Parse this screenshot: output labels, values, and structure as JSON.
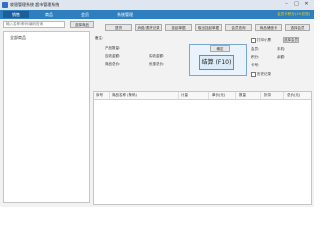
{
  "window": {
    "title": "收银管理系统 超市管理系统",
    "min_icon": "minimize-icon",
    "max_icon": "maximize-icon",
    "close_icon": "close-icon"
  },
  "nav": {
    "tabs": [
      {
        "label": "销售",
        "active": true
      },
      {
        "label": "商品"
      },
      {
        "label": "会员"
      },
      {
        "label": "系统管理"
      }
    ],
    "member_note": "会员卡积分(1%兑现)"
  },
  "left": {
    "search_placeholder": "输入名称/条码/编码查询",
    "search_button": "选择商品",
    "category_root": "全部商品"
  },
  "toolbar": {
    "buttons": [
      "退货",
      "消费/退货记录",
      "挂起单据",
      "取出挂起单据",
      "会员查询",
      "商品储值卡"
    ],
    "select_button": "选择会员"
  },
  "info": {
    "remark_label": "备注:",
    "quantity_label": "产品数量:",
    "receivable_label": "应收金额:",
    "received_label": "实收金额:",
    "total_label": "商品总价:",
    "discount_label": "优惠总价:",
    "member_label": "会员:",
    "points_label": "积分:",
    "phone_label": "手机:",
    "balance_label": "余额:",
    "card_label": "卡号:"
  },
  "actions": {
    "add_button": "确定",
    "settle_button": "结算 (F10)",
    "print_label": "打印小票",
    "history_label": "历史记录"
  },
  "grid": {
    "columns": [
      "序号",
      "商品名称 (条码)",
      "计量",
      "单价(元)",
      "数量",
      "折扣",
      "总价(元)"
    ]
  }
}
